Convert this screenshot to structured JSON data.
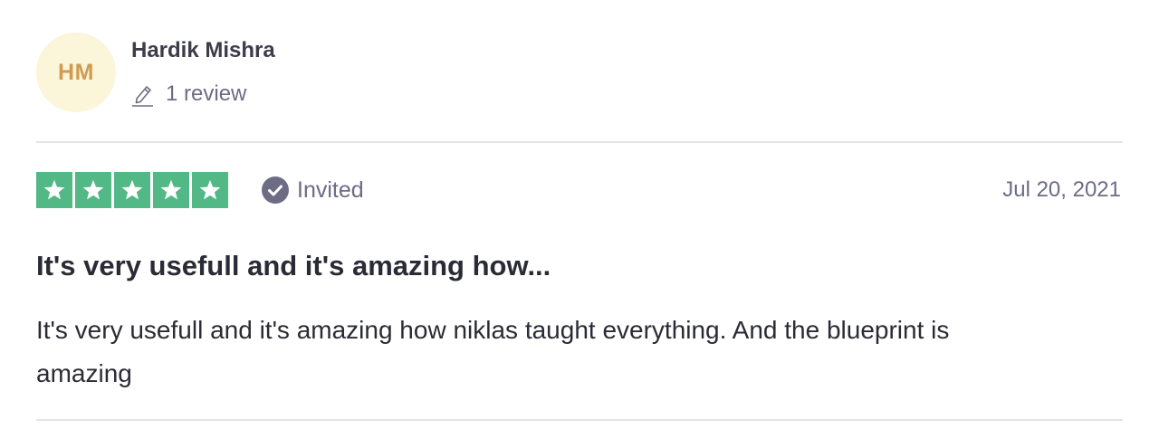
{
  "consumer": {
    "initials": "HM",
    "name": "Hardik Mishra",
    "review_count": "1 review",
    "avatar_bg": "#fbf5d9",
    "avatar_fg": "#d09b52"
  },
  "rating": {
    "stars": 5,
    "max_stars": 5,
    "star_color": "#52b886",
    "badge_icon": "check-circle-icon",
    "badge_label": "Invited",
    "date": "Jul 20, 2021"
  },
  "review": {
    "title": "It's very usefull and it's amazing how...",
    "body": "It's very usefull and it's amazing how niklas taught everything. And the blueprint is amazing"
  }
}
